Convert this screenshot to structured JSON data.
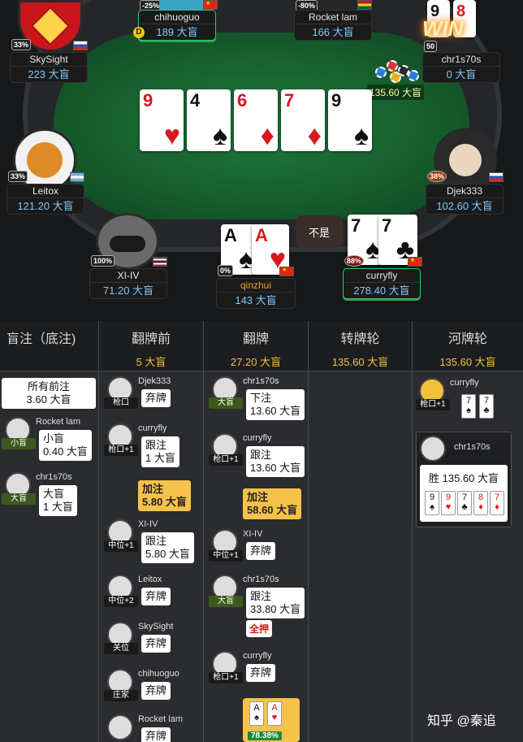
{
  "players": {
    "skysight": {
      "name": "SkySight",
      "stack": "223 大盲",
      "pct": "33%"
    },
    "chihuoguo": {
      "name": "chihuoguo",
      "stack": "189 大盲",
      "pct": "-25%"
    },
    "rocketlam": {
      "name": "Rocket lam",
      "stack": "166 大盲",
      "pct": "-80%"
    },
    "chr1s70s": {
      "name": "chr1s70s",
      "stack": "0 大盲",
      "pct": "50"
    },
    "leitox": {
      "name": "Leitox",
      "stack": "121.20 大盲",
      "pct": "33%"
    },
    "djek333": {
      "name": "Djek333",
      "stack": "102.60 大盲",
      "pct": "38%"
    },
    "xiiv": {
      "name": "XI-IV",
      "stack": "71.20 大盲",
      "pct": "100%"
    },
    "qinzhui": {
      "name": "qinzhui",
      "stack": "143 大盲",
      "pct": "0%"
    },
    "curryfly": {
      "name": "curryfly",
      "stack": "278.40 大盲",
      "pct": "88%"
    }
  },
  "board": [
    {
      "rank": "9",
      "suit": "♥",
      "color": "red"
    },
    {
      "rank": "4",
      "suit": "♠",
      "color": "blk"
    },
    {
      "rank": "6",
      "suit": "♦",
      "color": "red"
    },
    {
      "rank": "7",
      "suit": "♦",
      "color": "red"
    },
    {
      "rank": "9",
      "suit": "♠",
      "color": "blk"
    }
  ],
  "hero_cards": [
    {
      "rank": "A",
      "suit": "♠"
    },
    {
      "rank": "A",
      "suit": "♥"
    }
  ],
  "curryfly_cards": [
    {
      "rank": "7",
      "suit": "♠"
    },
    {
      "rank": "7",
      "suit": "♣"
    }
  ],
  "chr_cards": [
    {
      "rank": "9"
    },
    {
      "rank": "8"
    }
  ],
  "pot_label": "135.60 大盲",
  "win_label": "WIN",
  "speech_bubble": "不是",
  "dealer_label": "D",
  "history": {
    "columns": [
      {
        "title": "盲注（底注)",
        "value": ""
      },
      {
        "title": "翻牌前",
        "value": "5 大盲"
      },
      {
        "title": "翻牌",
        "value": "27.20 大盲"
      },
      {
        "title": "转牌轮",
        "value": "135.60 大盲"
      },
      {
        "title": "河牌轮",
        "value": "135.60 大盲"
      }
    ],
    "blinds": {
      "ante_label": "所有前注",
      "ante_value": "3.60 大盲",
      "sb_name": "Rocket lam",
      "sb_pos": "小盲",
      "sb_text1": "小盲",
      "sb_text2": "0.40 大盲",
      "bb_name": "chr1s70s",
      "bb_pos": "大盲",
      "bb_text1": "大盲",
      "bb_text2": "1 大盲"
    },
    "preflop": [
      {
        "name": "Djek333",
        "pos": "枪口",
        "l1": "弃牌",
        "l2": ""
      },
      {
        "name": "curryfly",
        "pos": "枪口+1",
        "l1": "跟注",
        "l2": "1 大盲"
      },
      {
        "name": "",
        "pos": "",
        "l1": "加注",
        "l2": "5.80 大盲",
        "raise": true
      },
      {
        "name": "XI-IV",
        "pos": "中位+1",
        "l1": "跟注",
        "l2": "5.80 大盲"
      },
      {
        "name": "Leitox",
        "pos": "中位+2",
        "l1": "弃牌",
        "l2": ""
      },
      {
        "name": "SkySight",
        "pos": "关位",
        "l1": "弃牌",
        "l2": ""
      },
      {
        "name": "chihuoguo",
        "pos": "庄家",
        "l1": "弃牌",
        "l2": ""
      },
      {
        "name": "Rocket lam",
        "pos": "",
        "l1": "弃牌",
        "l2": ""
      }
    ],
    "flop": [
      {
        "name": "chr1s70s",
        "pos": "大盲",
        "l1": "下注",
        "l2": "13.60 大盲"
      },
      {
        "name": "curryfly",
        "pos": "枪口+1",
        "l1": "跟注",
        "l2": "13.60 大盲"
      },
      {
        "name": "",
        "pos": "",
        "l1": "加注",
        "l2": "58.60 大盲",
        "raise": true
      },
      {
        "name": "XI-IV",
        "pos": "中位+1",
        "l1": "弃牌",
        "l2": ""
      },
      {
        "name": "chr1s70s",
        "pos": "大盲",
        "l1": "跟注",
        "l2": "33.80 大盲",
        "allin": "全押"
      },
      {
        "name": "curryfly",
        "pos": "枪口+1",
        "l1": "弃牌",
        "l2": ""
      }
    ],
    "flop_equity": "78.38%",
    "river": {
      "p1_name": "curryfly",
      "p1_pos": "枪口+1",
      "p2_name": "chr1s70s",
      "win_text": "胜 135.60 大盲"
    }
  },
  "watermark": "知乎 @秦追"
}
